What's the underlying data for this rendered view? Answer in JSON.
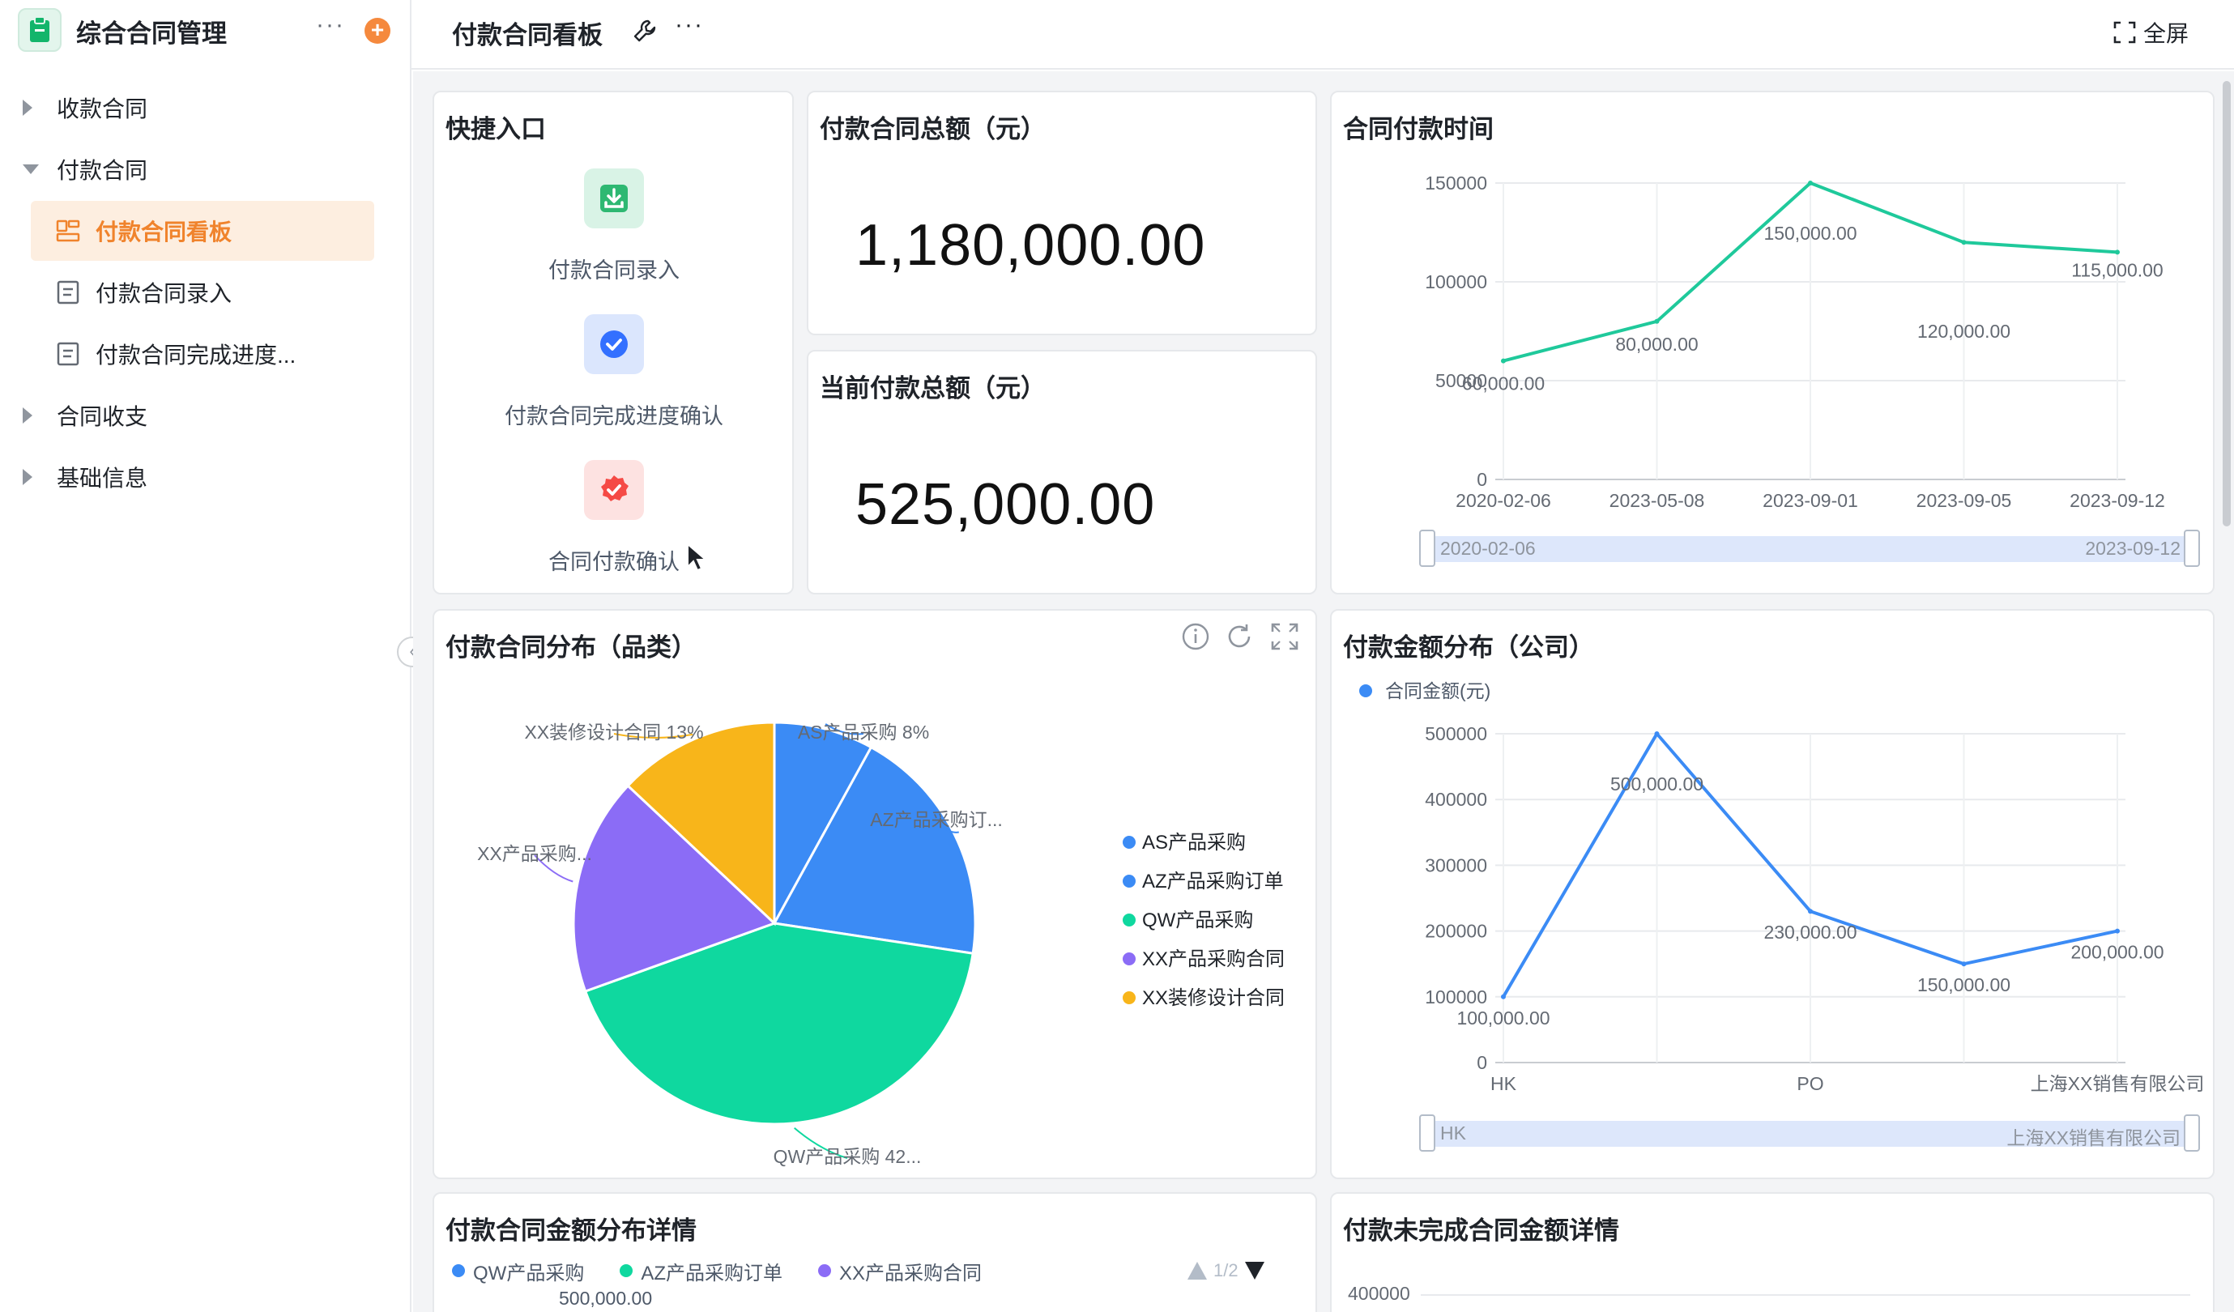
{
  "sidebar": {
    "app_title": "综合合同管理",
    "more": "···",
    "add": "+",
    "groups": [
      {
        "label": "收款合同",
        "expanded": false
      },
      {
        "label": "付款合同",
        "expanded": true
      },
      {
        "label": "合同收支",
        "expanded": false
      },
      {
        "label": "基础信息",
        "expanded": false
      }
    ],
    "sub_items": [
      {
        "label": "付款合同看板",
        "icon": "dashboard-icon",
        "active": true
      },
      {
        "label": "付款合同录入",
        "icon": "form-icon",
        "active": false
      },
      {
        "label": "付款合同完成进度...",
        "icon": "form-icon",
        "active": false
      }
    ],
    "collapse": "‹"
  },
  "header": {
    "title": "付款合同看板",
    "more": "···",
    "fullscreen_label": "全屏"
  },
  "cards": {
    "quick": {
      "title": "快捷入口",
      "items": [
        {
          "label": "付款合同录入",
          "icon": "download-icon",
          "color": "#2eb872"
        },
        {
          "label": "付款合同完成进度确认",
          "icon": "check-circle-icon",
          "color": "#3370ff"
        },
        {
          "label": "合同付款确认",
          "icon": "badge-check-icon",
          "color": "#f54a45"
        }
      ]
    },
    "total": {
      "title": "付款合同总额（元）",
      "value": "1,180,000.00"
    },
    "current": {
      "title": "当前付款总额（元）",
      "value": "525,000.00"
    },
    "time_chart": {
      "title": "合同付款时间",
      "range_start": "2020-02-06",
      "range_end": "2023-09-12"
    },
    "pie_chart": {
      "title": "付款合同分布（品类）"
    },
    "company_chart": {
      "title": "付款金额分布（公司）",
      "range_start": "HK",
      "range_end": "上海XX销售有限公司"
    },
    "detail": {
      "title": "付款合同金额分布详情",
      "pager": "1/2",
      "first_value": "500,000.00"
    },
    "unfinished": {
      "title": "付款未完成合同金额详情",
      "first_tick": "400000"
    }
  },
  "chart_data": [
    {
      "type": "line",
      "title": "合同付款时间",
      "x": [
        "2020-02-06",
        "2023-05-08",
        "2023-09-01",
        "2023-09-05",
        "2023-09-12"
      ],
      "y": [
        60000,
        80000,
        150000,
        120000,
        115000
      ],
      "data_labels": [
        "60,000.00",
        "80,000.00",
        "150,000.00",
        "120,000.00",
        "115,000.00"
      ],
      "yticks": [
        "0",
        "50000",
        "100000",
        "150000"
      ],
      "ylim": [
        0,
        150000
      ],
      "color": "#1fc99b",
      "grid": true
    },
    {
      "type": "pie",
      "title": "付款合同分布（品类）",
      "categories": [
        "AS产品采购",
        "AZ产品采购订单",
        "QW产品采购",
        "XX产品采购合同",
        "XX装修设计合同"
      ],
      "values": [
        8,
        19.4,
        42.1,
        17.5,
        13
      ],
      "colors": [
        "#3b8bf5",
        "#3b8bf5",
        "#0fd89f",
        "#8b6cf6",
        "#f8b51a"
      ],
      "slice_labels": [
        "AS产品采购 8%",
        "AZ产品采购订...",
        "QW产品采购 42...",
        "XX产品采购...",
        "XX装修设计合同 13%"
      ],
      "legend_position": "right"
    },
    {
      "type": "line",
      "title": "付款金额分布（公司）",
      "series_name": "合同金额(元)",
      "x": [
        "HK",
        "",
        "PO",
        "",
        "上海XX销售有限公司"
      ],
      "y": [
        100000,
        500000,
        230000,
        150000,
        200000
      ],
      "data_labels": [
        "100,000.00",
        "500,000.00",
        "230,000.00",
        "150,000.00",
        "200,000.00"
      ],
      "yticks": [
        "0",
        "100000",
        "200000",
        "300000",
        "400000",
        "500000"
      ],
      "ylim": [
        0,
        500000
      ],
      "color": "#3b8bf5",
      "legend_position": "top-left",
      "grid": true
    },
    {
      "type": "bar",
      "title": "付款合同金额分布详情",
      "legend": [
        {
          "name": "QW产品采购",
          "color": "#3b8bf5"
        },
        {
          "name": "AZ产品采购订单",
          "color": "#0fd89f"
        },
        {
          "name": "XX产品采购合同",
          "color": "#8b6cf6"
        }
      ]
    }
  ]
}
